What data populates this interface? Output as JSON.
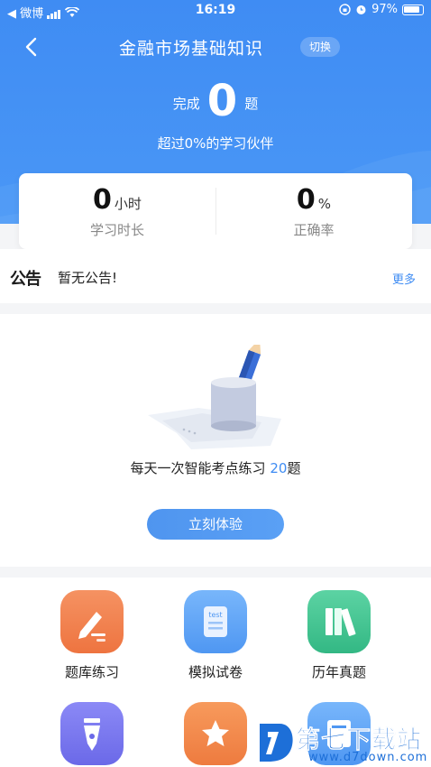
{
  "status_bar": {
    "carrier": "◀ 微博",
    "time": "16:19",
    "battery": "97%"
  },
  "nav": {
    "title": "金融市场基础知识",
    "switch_label": "切换"
  },
  "summary": {
    "prefix": "完成",
    "count": "0",
    "suffix": "题",
    "beat_text": "超过0%的学习伙伴"
  },
  "stats": {
    "study_time": {
      "value": "0",
      "unit": "小时",
      "label": "学习时长"
    },
    "accuracy": {
      "value": "0",
      "unit": "%",
      "label": "正确率"
    }
  },
  "notice": {
    "tag": "公告",
    "text": "暂无公告!",
    "more": "更多"
  },
  "practice": {
    "text_prefix": "每天一次智能考点练习",
    "count": "20",
    "text_suffix": "题",
    "button_label": "立刻体验"
  },
  "grid": {
    "items": [
      {
        "label": "题库练习",
        "icon": "pen-write-icon",
        "color": "#f27e4b"
      },
      {
        "label": "模拟试卷",
        "icon": "test-paper-icon",
        "color": "#5ea6f7"
      },
      {
        "label": "历年真题",
        "icon": "books-icon",
        "color": "#3ec591"
      },
      {
        "label": "",
        "icon": "fountain-pen-icon",
        "color": "#7a78f0"
      },
      {
        "label": "",
        "icon": "star-icon",
        "color": "#f2894a"
      },
      {
        "label": "",
        "icon": "document-icon",
        "color": "#5ea6f7"
      }
    ]
  },
  "watermark": {
    "title": "第七下载站",
    "url": "www.d7down.com"
  }
}
